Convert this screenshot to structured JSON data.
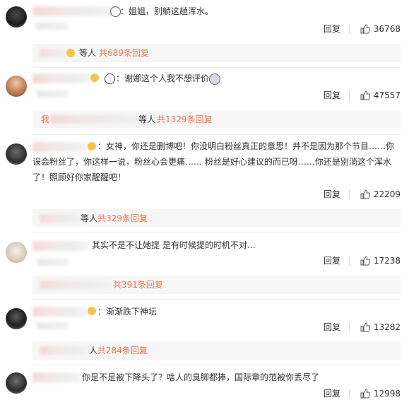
{
  "reply_label": "回复",
  "comments": [
    {
      "text": "：姐姐，别躺这趟浑水。",
      "likes": "36768",
      "sub_prefix": "等人",
      "sub_count": "共689条回复"
    },
    {
      "text": "：谢娜这个人我不想评价",
      "likes": "47557",
      "sub_pre": "我",
      "sub_prefix": "等人",
      "sub_count": "共1329条回复"
    },
    {
      "text_line1": "：女神，你还是删博吧！你没明白粉丝真正的意思！并不是因为那个节目……你",
      "text_line2": "误会粉丝了，你这样一说，粉丝心会更痛…… 粉丝是好心建议的而已呀……你还是别淌这个浑水",
      "text_line3": "了！照顾好你家醒醒吧！",
      "likes": "22209",
      "sub_prefix": "等人",
      "sub_count": "共329条回复"
    },
    {
      "text": "其实不是不让她提 是有时候提的时机不对…",
      "likes": "17238",
      "sub_count": "共391条回复"
    },
    {
      "text": "：渐渐跌下神坛",
      "likes": "13282",
      "sub_prefix": "人",
      "sub_count": "共284条回复"
    },
    {
      "text": "你是不是被下降头了？啥人的臭脚都捧，国际章的范被你丢尽了",
      "likes": "12998"
    }
  ],
  "colors": {
    "accent": "#eb7350",
    "sub_bg": "#f6f6f6",
    "text": "#333333"
  },
  "icons": [
    "thumb-up-icon",
    "panda-emoji",
    "crying-emoji",
    "gold-badge-icon"
  ]
}
